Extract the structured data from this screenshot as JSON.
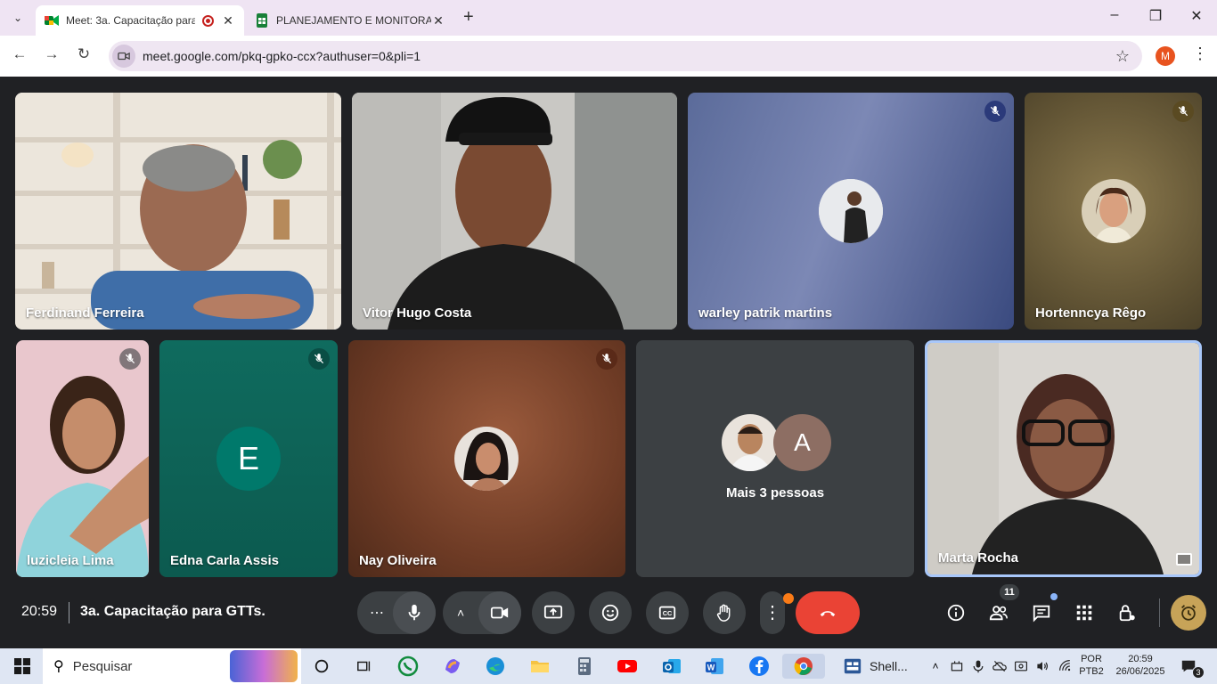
{
  "browser": {
    "tabs": [
      {
        "title": "Meet: 3a. Capacitação para",
        "active": true,
        "favicon_color": "#00832d",
        "recording": true
      },
      {
        "title": "PLANEJAMENTO E MONITORAM",
        "active": false,
        "favicon_color": "#188038"
      }
    ],
    "url": "meet.google.com/pkq-gpko-ccx?authuser=0&pli=1",
    "profile_initial": "M",
    "profile_color": "#e8531f"
  },
  "participants": [
    {
      "name": "Ferdinand Ferreira",
      "muted": false
    },
    {
      "name": "Vitor Hugo Costa",
      "muted": false
    },
    {
      "name": "warley patrik martins",
      "muted": true
    },
    {
      "name": "Hortenncya Rêgo",
      "muted": true
    },
    {
      "name": "luzicleia Lima",
      "muted": true
    },
    {
      "name": "Edna Carla Assis",
      "muted": true,
      "avatar_letter": "E",
      "avatar_color": "#00796b"
    },
    {
      "name": "Nay Oliveira",
      "muted": true
    },
    {
      "name": "Marta Rocha",
      "muted": false,
      "highlighted": true
    }
  ],
  "more_people": {
    "label": "Mais 3 pessoas",
    "avatar_letter": "A",
    "avatar_color": "#8d6e63"
  },
  "meeting": {
    "time": "20:59",
    "title": "3a. Capacitação para GTTs.",
    "participant_count": "11"
  },
  "taskbar": {
    "search_placeholder": "Pesquisar",
    "shell_label": "Shell...",
    "lang_line1": "POR",
    "lang_line2": "PTB2",
    "clock_time": "20:59",
    "clock_date": "26/06/2025",
    "notification_count": "3"
  },
  "colors": {
    "meet_bg": "#202124",
    "end_call": "#ea4335",
    "control_btn": "#3c4043",
    "active_tile_border": "#a8c7fa"
  }
}
